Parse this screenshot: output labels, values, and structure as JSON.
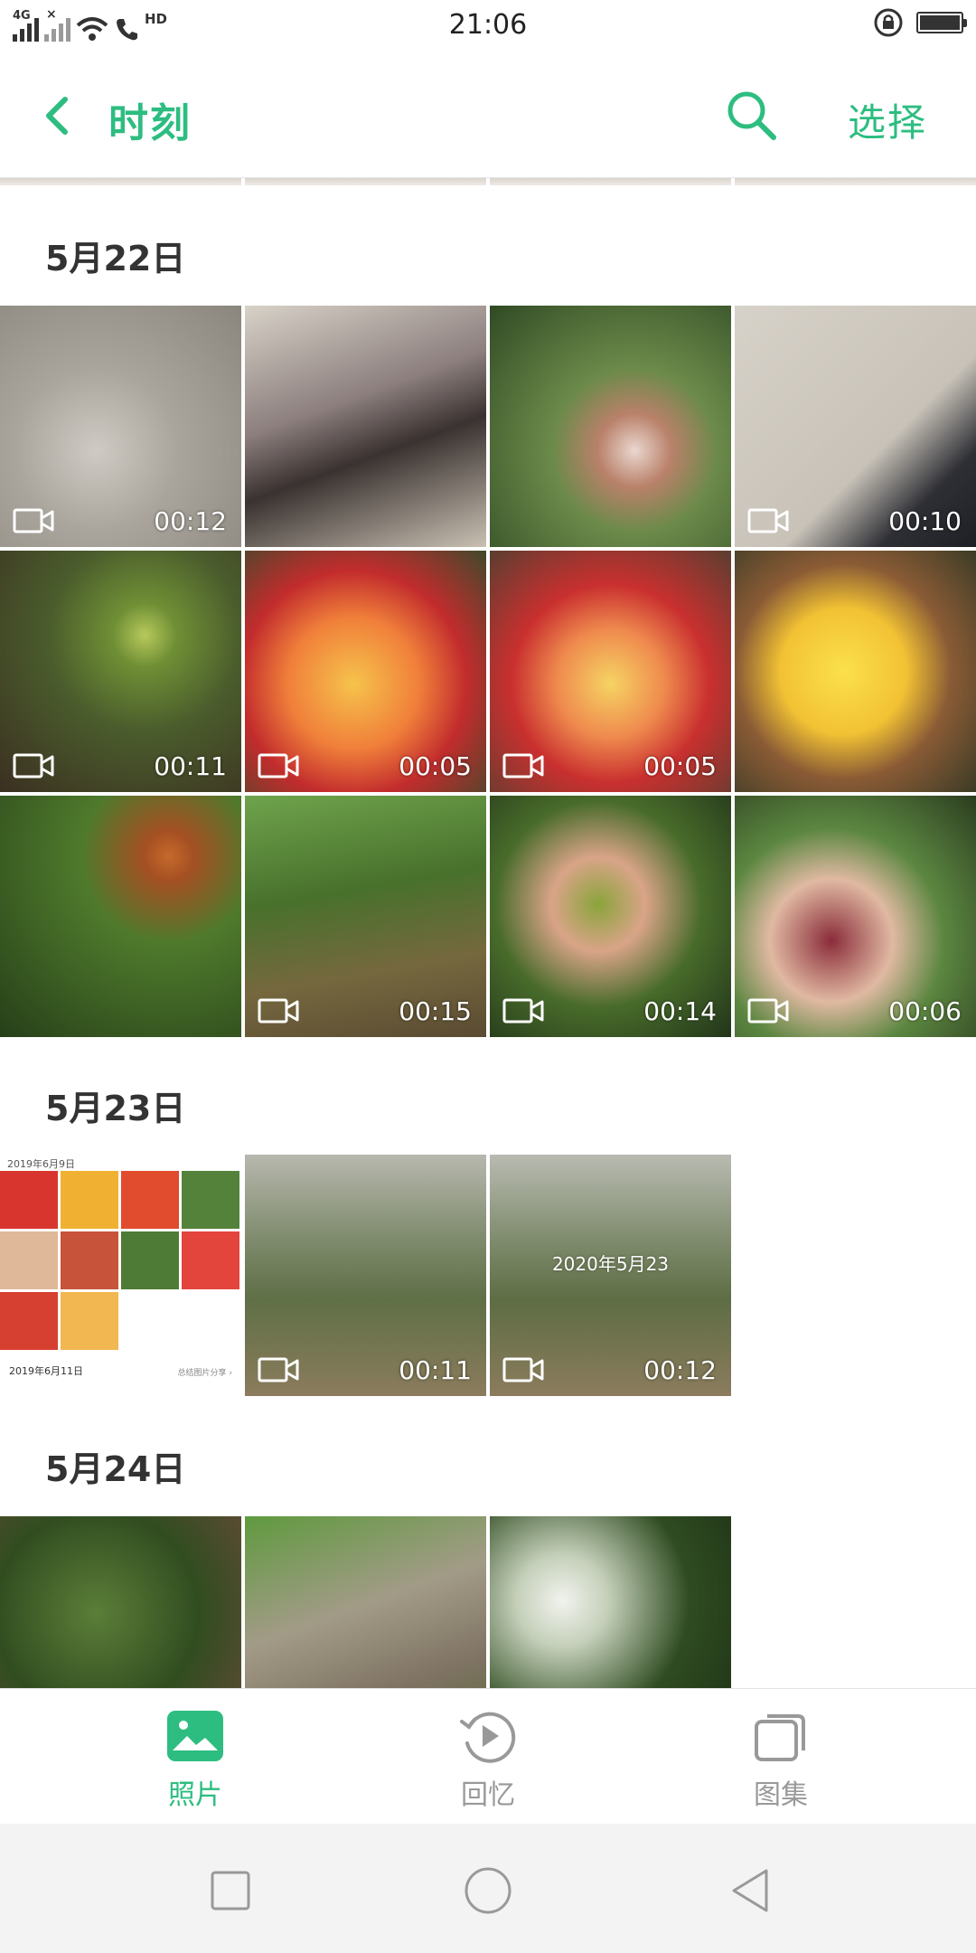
{
  "status_bar": {
    "network": "4G",
    "hd": "HD",
    "time": "21:06",
    "battery_percent": 100
  },
  "header": {
    "title": "时刻",
    "select_label": "选择"
  },
  "sections": [
    {
      "date": "5月22日",
      "items": [
        {
          "type": "video",
          "duration": "00:12"
        },
        {
          "type": "photo"
        },
        {
          "type": "photo"
        },
        {
          "type": "video",
          "duration": "00:10"
        },
        {
          "type": "video",
          "duration": "00:11"
        },
        {
          "type": "video",
          "duration": "00:05"
        },
        {
          "type": "video",
          "duration": "00:05"
        },
        {
          "type": "photo"
        },
        {
          "type": "photo"
        },
        {
          "type": "video",
          "duration": "00:15"
        },
        {
          "type": "video",
          "duration": "00:14"
        },
        {
          "type": "video",
          "duration": "00:06"
        }
      ]
    },
    {
      "date": "5月23日",
      "collage": {
        "header": "2019年6月9日",
        "footer": "2019年6月11日",
        "link": "总结图片分享 ›"
      },
      "items": [
        {
          "type": "photo"
        },
        {
          "type": "video",
          "duration": "00:11"
        },
        {
          "type": "video",
          "duration": "00:12",
          "stamp": "2020年5月23"
        }
      ]
    },
    {
      "date": "5月24日",
      "items": [
        {
          "type": "photo"
        },
        {
          "type": "photo"
        },
        {
          "type": "photo"
        }
      ]
    }
  ],
  "bottom_nav": {
    "photos": "照片",
    "memories": "回忆",
    "albums": "图集"
  },
  "colors": {
    "accent": "#2dbd80",
    "inactive": "#999999"
  },
  "icons": [
    "back-icon",
    "search-icon",
    "video-icon",
    "photos-icon",
    "memories-icon",
    "albums-icon"
  ]
}
